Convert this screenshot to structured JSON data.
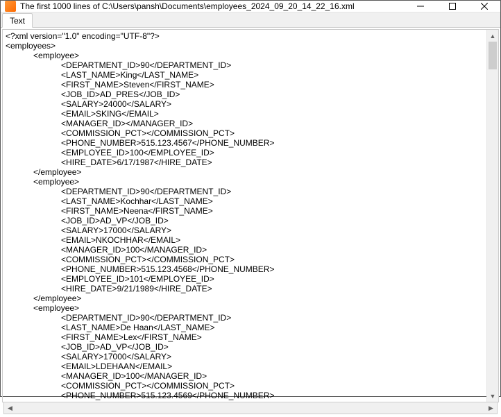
{
  "window": {
    "title": "The first 1000 lines of C:\\Users\\pansh\\Documents\\employees_2024_09_20_14_22_16.xml"
  },
  "tabs": {
    "text": "Text"
  },
  "xml": {
    "prolog": "<?xml version=\"1.0\" encoding=\"UTF-8\"?>",
    "root_open": "<employees>",
    "employee_open": "<employee>",
    "employee_close": "</employee>",
    "records": [
      {
        "DEPARTMENT_ID": "90",
        "LAST_NAME": "King",
        "FIRST_NAME": "Steven",
        "JOB_ID": "AD_PRES",
        "SALARY": "24000",
        "EMAIL": "SKING",
        "MANAGER_ID": "",
        "COMMISSION_PCT": "",
        "PHONE_NUMBER": "515.123.4567",
        "EMPLOYEE_ID": "100",
        "HIRE_DATE": "6/17/1987"
      },
      {
        "DEPARTMENT_ID": "90",
        "LAST_NAME": "Kochhar",
        "FIRST_NAME": "Neena",
        "JOB_ID": "AD_VP",
        "SALARY": "17000",
        "EMAIL": "NKOCHHAR",
        "MANAGER_ID": "100",
        "COMMISSION_PCT": "",
        "PHONE_NUMBER": "515.123.4568",
        "EMPLOYEE_ID": "101",
        "HIRE_DATE": "9/21/1989"
      },
      {
        "DEPARTMENT_ID": "90",
        "LAST_NAME": "De Haan",
        "FIRST_NAME": "Lex",
        "JOB_ID": "AD_VP",
        "SALARY": "17000",
        "EMAIL": "LDEHAAN",
        "MANAGER_ID": "100",
        "COMMISSION_PCT": "",
        "PHONE_NUMBER": "515.123.4569",
        "EMPLOYEE_ID": "",
        "HIRE_DATE": ""
      }
    ],
    "field_order": [
      "DEPARTMENT_ID",
      "LAST_NAME",
      "FIRST_NAME",
      "JOB_ID",
      "SALARY",
      "EMAIL",
      "MANAGER_ID",
      "COMMISSION_PCT",
      "PHONE_NUMBER",
      "EMPLOYEE_ID",
      "HIRE_DATE"
    ],
    "indent_employee": "            ",
    "indent_field": "                        ",
    "third_visible_fields": 9
  }
}
